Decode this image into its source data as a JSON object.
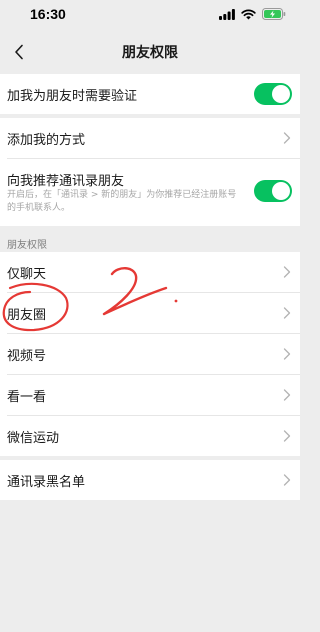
{
  "status_bar": {
    "time": "16:30",
    "icons": [
      "signal-icon",
      "wifi-icon",
      "battery-charging-icon"
    ],
    "battery_color": "#34c759"
  },
  "nav": {
    "title": "朋友权限",
    "back_icon": "chevron-left-icon"
  },
  "settings": {
    "verify_friend": {
      "label": "加我为朋友时需要验证",
      "enabled": true
    },
    "add_methods": {
      "label": "添加我的方式"
    },
    "recommend_contacts": {
      "label": "向我推荐通讯录朋友",
      "description": "开启后，在「通讯录 > 新的朋友」为你推荐已经注册账号的手机联系人。",
      "enabled": true
    }
  },
  "friend_permissions": {
    "header": "朋友权限",
    "items": [
      {
        "label": "仅聊天"
      },
      {
        "label": "朋友圈"
      },
      {
        "label": "视频号"
      },
      {
        "label": "看一看"
      },
      {
        "label": "微信运动"
      }
    ]
  },
  "blacklist": {
    "label": "通讯录黑名单"
  },
  "colors": {
    "accent": "#07c160",
    "background": "#ededed",
    "annotation": "#e53935"
  },
  "annotation": {
    "number_text": "2",
    "circled_item": "朋友圈"
  }
}
